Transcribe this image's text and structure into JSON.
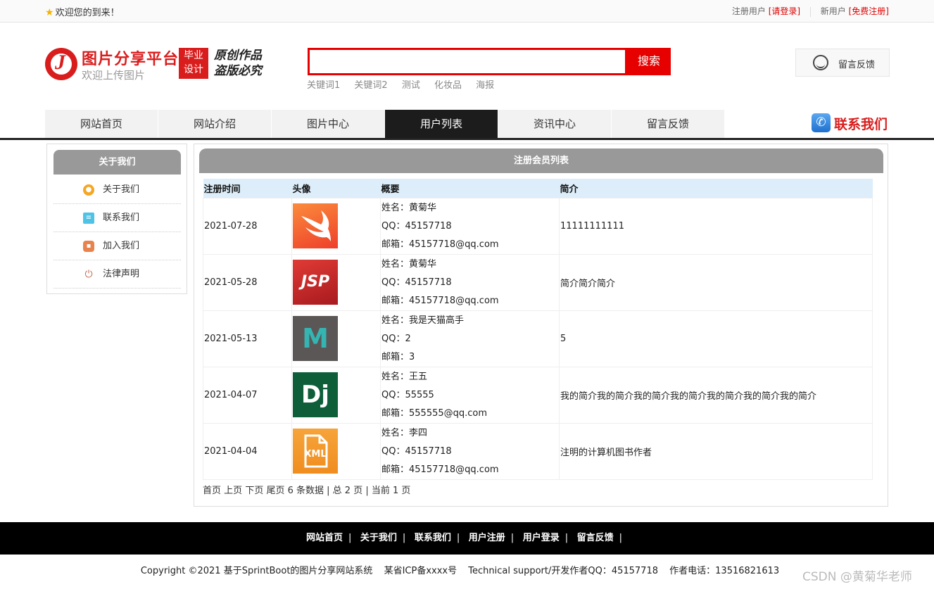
{
  "topbar": {
    "welcome": "欢迎您的到来！",
    "register_user_label": "注册用户",
    "login_link": "[请登录]",
    "new_user_label": "新用户",
    "free_register_link": "[免费注册]"
  },
  "header": {
    "logo_title": "图片分享平台",
    "logo_subtitle": "欢迎上传图片",
    "badge_line1": "毕业",
    "badge_line2": "设计",
    "slogan_line1": "原创作品",
    "slogan_line2": "盗版必究",
    "search_button": "搜索",
    "search_value": "",
    "keywords": [
      "关键词1",
      "关键词2",
      "测试",
      "化妆品",
      "海报"
    ],
    "feedback_button": "留言反馈"
  },
  "nav": {
    "items": [
      "网站首页",
      "网站介绍",
      "图片中心",
      "用户列表",
      "资讯中心",
      "留言反馈"
    ],
    "active_index": 3,
    "contact": "联系我们"
  },
  "sidebar": {
    "title": "关于我们",
    "items": [
      {
        "label": "关于我们",
        "icon": "info-icon",
        "color": "#f5a623"
      },
      {
        "label": "联系我们",
        "icon": "clipboard-icon",
        "color": "#4fc3e6"
      },
      {
        "label": "加入我们",
        "icon": "lock-icon",
        "color": "#e8834e"
      },
      {
        "label": "法律声明",
        "icon": "power-icon",
        "color": "#c96a4e"
      }
    ]
  },
  "main": {
    "title": "注册会员列表",
    "columns": [
      "注册时间",
      "头像",
      "概要",
      "简介"
    ],
    "rows": [
      {
        "date": "2021-07-28",
        "avatar": "swift-logo",
        "name": "姓名：黄菊华",
        "qq": "QQ：45157718",
        "email": "邮箱：45157718@qq.com",
        "intro": "11111111111"
      },
      {
        "date": "2021-05-28",
        "avatar": "jsp-logo",
        "avatar_text": "JSP",
        "name": "姓名：黄菊华",
        "qq": "QQ：45157718",
        "email": "邮箱：45157718@qq.com",
        "intro": "简介简介简介"
      },
      {
        "date": "2021-05-13",
        "avatar": "m-logo",
        "avatar_text": "M",
        "name": "姓名：我是天猫高手",
        "qq": "QQ：2",
        "email": "邮箱：3",
        "intro": "5"
      },
      {
        "date": "2021-04-07",
        "avatar": "django-logo",
        "avatar_text": "Dj",
        "name": "姓名：王五",
        "qq": "QQ：55555",
        "email": "邮箱：555555@qq.com",
        "intro": "我的简介我的简介我的简介我的简介我的简介我的简介我的简介"
      },
      {
        "date": "2021-04-04",
        "avatar": "xml-file-logo",
        "avatar_text": "XML",
        "name": "姓名：李四",
        "qq": "QQ：45157718",
        "email": "邮箱：45157718@qq.com",
        "intro": "注明的计算机图书作者"
      }
    ],
    "pager": {
      "first": "首页",
      "prev": "上页",
      "next": "下页",
      "last": "尾页",
      "summary": "6 条数据 | 总 2 页 | 当前 1 页"
    }
  },
  "footer": {
    "links": [
      "网站首页",
      "关于我们",
      "联系我们",
      "用户注册",
      "用户登录",
      "留言反馈"
    ],
    "separator": "|",
    "copyright": "Copyright ©2021 基于SprintBoot的图片分享网站系统",
    "icp": "某省ICP备xxxx号",
    "support": "Technical support/开发作者QQ：45157718",
    "phone": "作者电话：13516821613"
  },
  "watermark": "CSDN @黄菊华老师"
}
